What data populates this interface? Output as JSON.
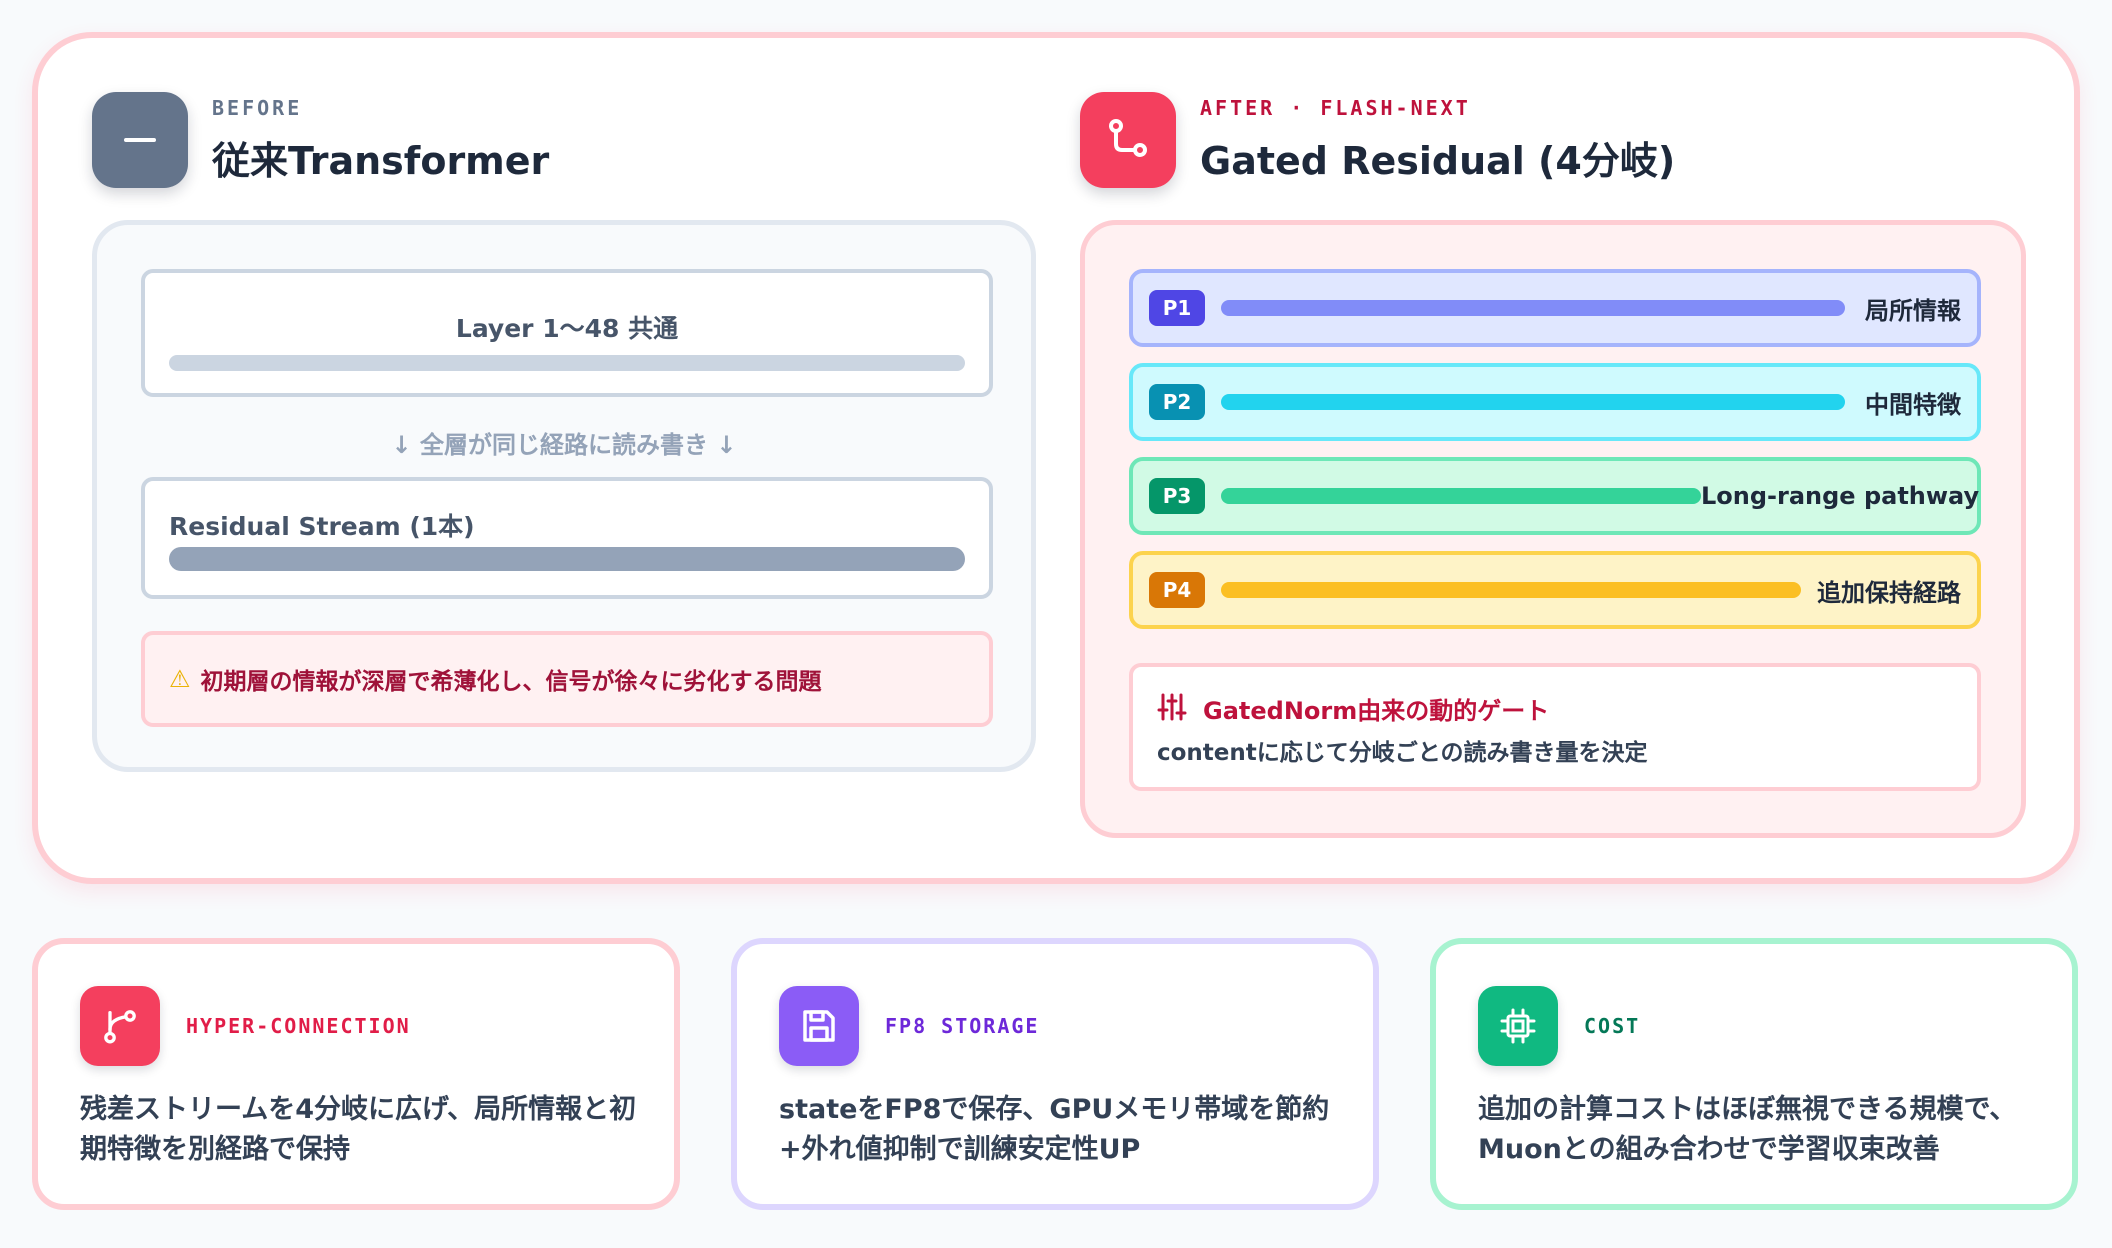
{
  "before": {
    "kicker": "BEFORE",
    "title": "従来Transformer",
    "layer_label": "Layer 1〜48 共通",
    "rw_note": "↓ 全層が同じ経路に読み書き ↓",
    "stream_label": "Residual Stream (1本)",
    "warning": "初期層の情報が深層で希薄化し、信号が徐々に劣化する問題",
    "icon": "minus-icon",
    "warning_icon": "warning-icon"
  },
  "after": {
    "kicker": "AFTER · FLASH-NEXT",
    "title": "Gated Residual (4分岐)",
    "icon": "branch-icon",
    "paths": [
      {
        "badge": "P1",
        "label": "局所情報",
        "color": "#4f46e5",
        "bar_color": "#818cf8",
        "bg": "#e0e7ff",
        "border": "#a5b4fc",
        "fill": 1.0
      },
      {
        "badge": "P2",
        "label": "中間特徴",
        "color": "#0891b2",
        "bar_color": "#22d3ee",
        "bg": "#cffafe",
        "border": "#67e8f9",
        "fill": 1.0
      },
      {
        "badge": "P3",
        "label": "Long-range pathway",
        "color": "#059669",
        "bar_color": "#34d399",
        "bg": "#d1fae5",
        "border": "#6ee7b7",
        "fill": 0.77
      },
      {
        "badge": "P4",
        "label": "追加保持経路",
        "color": "#d97706",
        "bar_color": "#fbbf24",
        "bg": "#fef3c7",
        "border": "#fcd34d",
        "fill": 0.93
      }
    ],
    "gate_title": "GatedNorm由来の動的ゲート",
    "gate_desc": "contentに応じて分岐ごとの読み書き量を決定",
    "gate_icon": "sliders-icon"
  },
  "features": [
    {
      "kicker": "HYPER-CONNECTION",
      "desc": "残差ストリームを4分岐に広げ、局所情報と初期特徴を別経路で保持",
      "icon": "branch-icon",
      "accent": "#e11d48"
    },
    {
      "kicker": "FP8 STORAGE",
      "desc": "stateをFP8で保存、GPUメモリ帯域を節約+外れ値抑制で訓練安定性UP",
      "icon": "save-icon",
      "accent": "#6d28d9"
    },
    {
      "kicker": "COST",
      "desc": "追加の計算コストはほぼ無視できる規模で、Muonとの組み合わせで学習収束改善",
      "icon": "chip-icon",
      "accent": "#047857"
    }
  ],
  "colors": {
    "rose": "#f43f5e",
    "slate": "#64748b",
    "violet": "#8b5cf6",
    "emerald": "#10b981"
  }
}
